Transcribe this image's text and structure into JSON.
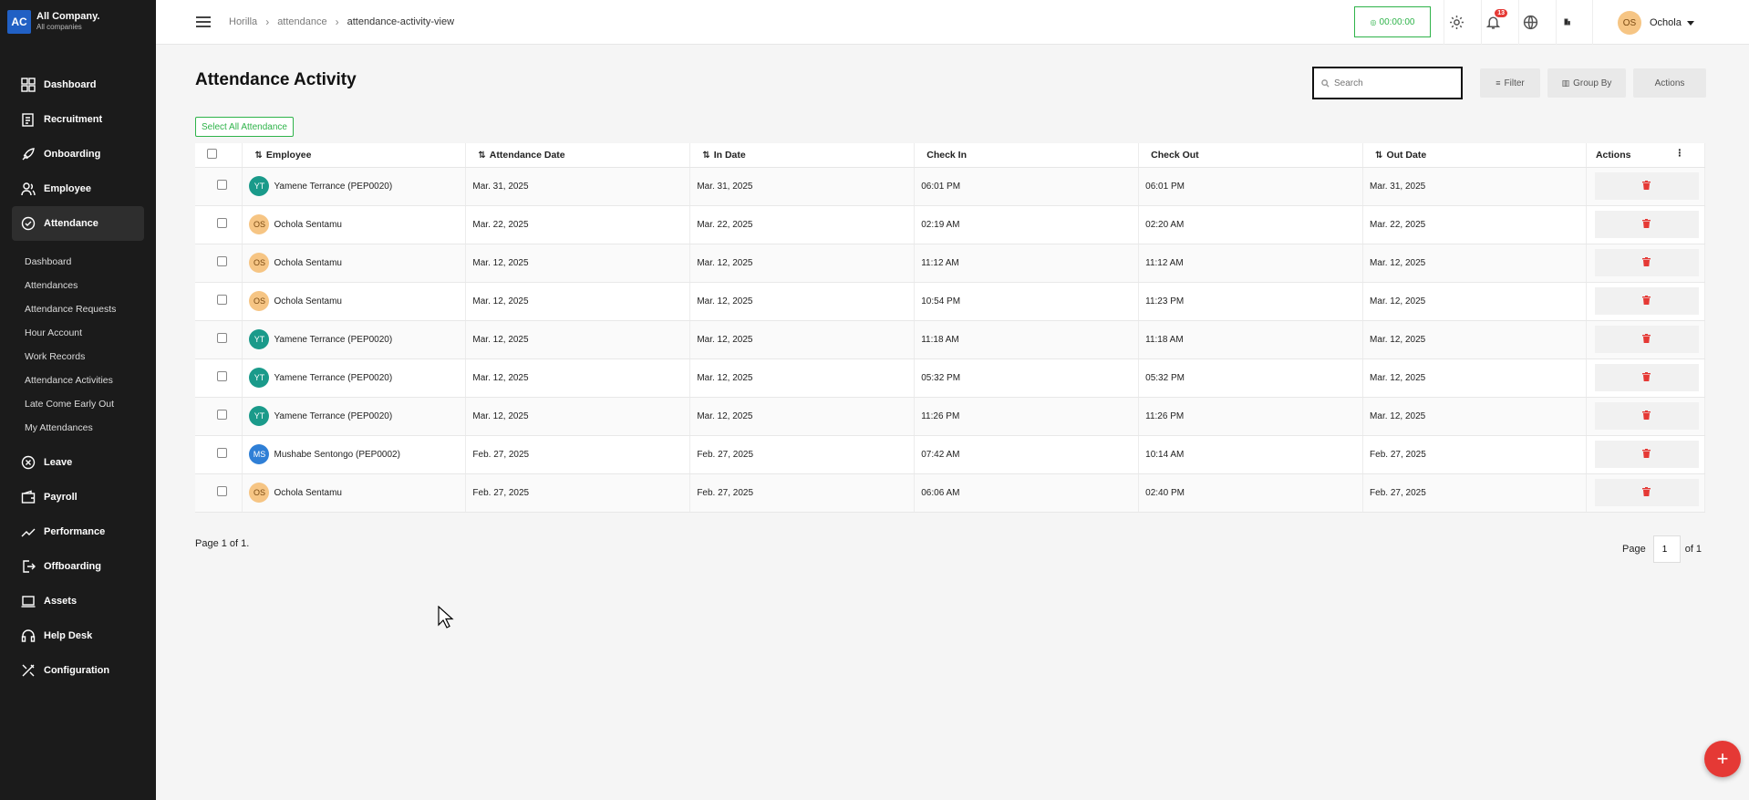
{
  "company": {
    "logo": "AC",
    "name": "All Company.",
    "sub": "All companies"
  },
  "sidebar": {
    "items": [
      {
        "label": "Dashboard",
        "icon": "dashboard-icon"
      },
      {
        "label": "Recruitment",
        "icon": "recruitment-icon"
      },
      {
        "label": "Onboarding",
        "icon": "rocket-icon"
      },
      {
        "label": "Employee",
        "icon": "people-icon"
      },
      {
        "label": "Attendance",
        "icon": "check-circle-icon"
      }
    ],
    "subitems": [
      "Dashboard",
      "Attendances",
      "Attendance Requests",
      "Hour Account",
      "Work Records",
      "Attendance Activities",
      "Late Come Early Out",
      "My Attendances"
    ],
    "bottom_items": [
      {
        "label": "Leave",
        "icon": "leave-icon"
      },
      {
        "label": "Payroll",
        "icon": "wallet-icon"
      },
      {
        "label": "Performance",
        "icon": "trend-icon"
      },
      {
        "label": "Offboarding",
        "icon": "exit-icon"
      },
      {
        "label": "Assets",
        "icon": "laptop-icon"
      },
      {
        "label": "Help Desk",
        "icon": "headset-icon"
      },
      {
        "label": "Configuration",
        "icon": "tools-icon"
      }
    ]
  },
  "topbar": {
    "breadcrumb": [
      "Horilla",
      "attendance",
      "attendance-activity-view"
    ],
    "timer": "00:00:00",
    "notification_count": "13",
    "user_initials": "OS",
    "user_name": "Ochola"
  },
  "page": {
    "title": "Attendance Activity",
    "search_placeholder": "Search",
    "filter_label": "Filter",
    "groupby_label": "Group By",
    "actions_label": "Actions",
    "select_all_label": "Select All Attendance"
  },
  "table": {
    "headers": {
      "employee": "Employee",
      "attendance_date": "Attendance Date",
      "in_date": "In Date",
      "check_in": "Check In",
      "check_out": "Check Out",
      "out_date": "Out Date",
      "actions": "Actions"
    },
    "rows": [
      {
        "initials": "YT",
        "avatar_color": "#1a9a8a",
        "employee": "Yamene Terrance (PEP0020)",
        "attendance_date": "Mar. 31, 2025",
        "in_date": "Mar. 31, 2025",
        "check_in": "06:01 PM",
        "check_out": "06:01 PM",
        "out_date": "Mar. 31, 2025"
      },
      {
        "initials": "OS",
        "avatar_color": "#f6c584",
        "employee": "Ochola Sentamu",
        "attendance_date": "Mar. 22, 2025",
        "in_date": "Mar. 22, 2025",
        "check_in": "02:19 AM",
        "check_out": "02:20 AM",
        "out_date": "Mar. 22, 2025"
      },
      {
        "initials": "OS",
        "avatar_color": "#f6c584",
        "employee": "Ochola Sentamu",
        "attendance_date": "Mar. 12, 2025",
        "in_date": "Mar. 12, 2025",
        "check_in": "11:12 AM",
        "check_out": "11:12 AM",
        "out_date": "Mar. 12, 2025"
      },
      {
        "initials": "OS",
        "avatar_color": "#f6c584",
        "employee": "Ochola Sentamu",
        "attendance_date": "Mar. 12, 2025",
        "in_date": "Mar. 12, 2025",
        "check_in": "10:54 PM",
        "check_out": "11:23 PM",
        "out_date": "Mar. 12, 2025"
      },
      {
        "initials": "YT",
        "avatar_color": "#1a9a8a",
        "employee": "Yamene Terrance (PEP0020)",
        "attendance_date": "Mar. 12, 2025",
        "in_date": "Mar. 12, 2025",
        "check_in": "11:18 AM",
        "check_out": "11:18 AM",
        "out_date": "Mar. 12, 2025"
      },
      {
        "initials": "YT",
        "avatar_color": "#1a9a8a",
        "employee": "Yamene Terrance (PEP0020)",
        "attendance_date": "Mar. 12, 2025",
        "in_date": "Mar. 12, 2025",
        "check_in": "05:32 PM",
        "check_out": "05:32 PM",
        "out_date": "Mar. 12, 2025"
      },
      {
        "initials": "YT",
        "avatar_color": "#1a9a8a",
        "employee": "Yamene Terrance (PEP0020)",
        "attendance_date": "Mar. 12, 2025",
        "in_date": "Mar. 12, 2025",
        "check_in": "11:26 PM",
        "check_out": "11:26 PM",
        "out_date": "Mar. 12, 2025"
      },
      {
        "initials": "MS",
        "avatar_color": "#2f7fd6",
        "employee": "Mushabe Sentongo (PEP0002)",
        "attendance_date": "Feb. 27, 2025",
        "in_date": "Feb. 27, 2025",
        "check_in": "07:42 AM",
        "check_out": "10:14 AM",
        "out_date": "Feb. 27, 2025"
      },
      {
        "initials": "OS",
        "avatar_color": "#f6c584",
        "employee": "Ochola Sentamu",
        "attendance_date": "Feb. 27, 2025",
        "in_date": "Feb. 27, 2025",
        "check_in": "06:06 AM",
        "check_out": "02:40 PM",
        "out_date": "Feb. 27, 2025"
      }
    ]
  },
  "pagination": {
    "summary": "Page 1 of 1.",
    "page_label": "Page",
    "current": "1",
    "of_label": "of 1"
  },
  "colors": {
    "accent_green": "#2fb34a",
    "danger_red": "#e53935",
    "sidebar_bg": "#1b1b1b"
  }
}
